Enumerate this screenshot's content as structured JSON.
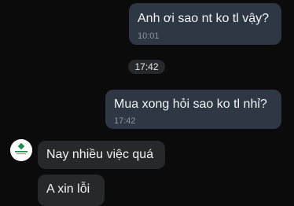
{
  "messages": [
    {
      "direction": "outgoing",
      "text": "Anh ơi sao nt ko tl vậy?",
      "time": "10:01"
    },
    {
      "direction": "outgoing",
      "text": "Mua xong hỏi sao ko tl nhỉ?",
      "time": "17:42"
    },
    {
      "direction": "incoming",
      "text": "Nay nhiều việc quá"
    },
    {
      "direction": "incoming",
      "text": "A xin lỗi"
    }
  ],
  "separator_time": "17:42",
  "avatar_icon": "shop-logo-icon",
  "colors": {
    "background": "#0b0b0b",
    "outgoing_bubble": "#2e3844",
    "incoming_bubble": "#262829",
    "timestamp": "#8b96a3",
    "logo_green": "#1f8a4c"
  }
}
